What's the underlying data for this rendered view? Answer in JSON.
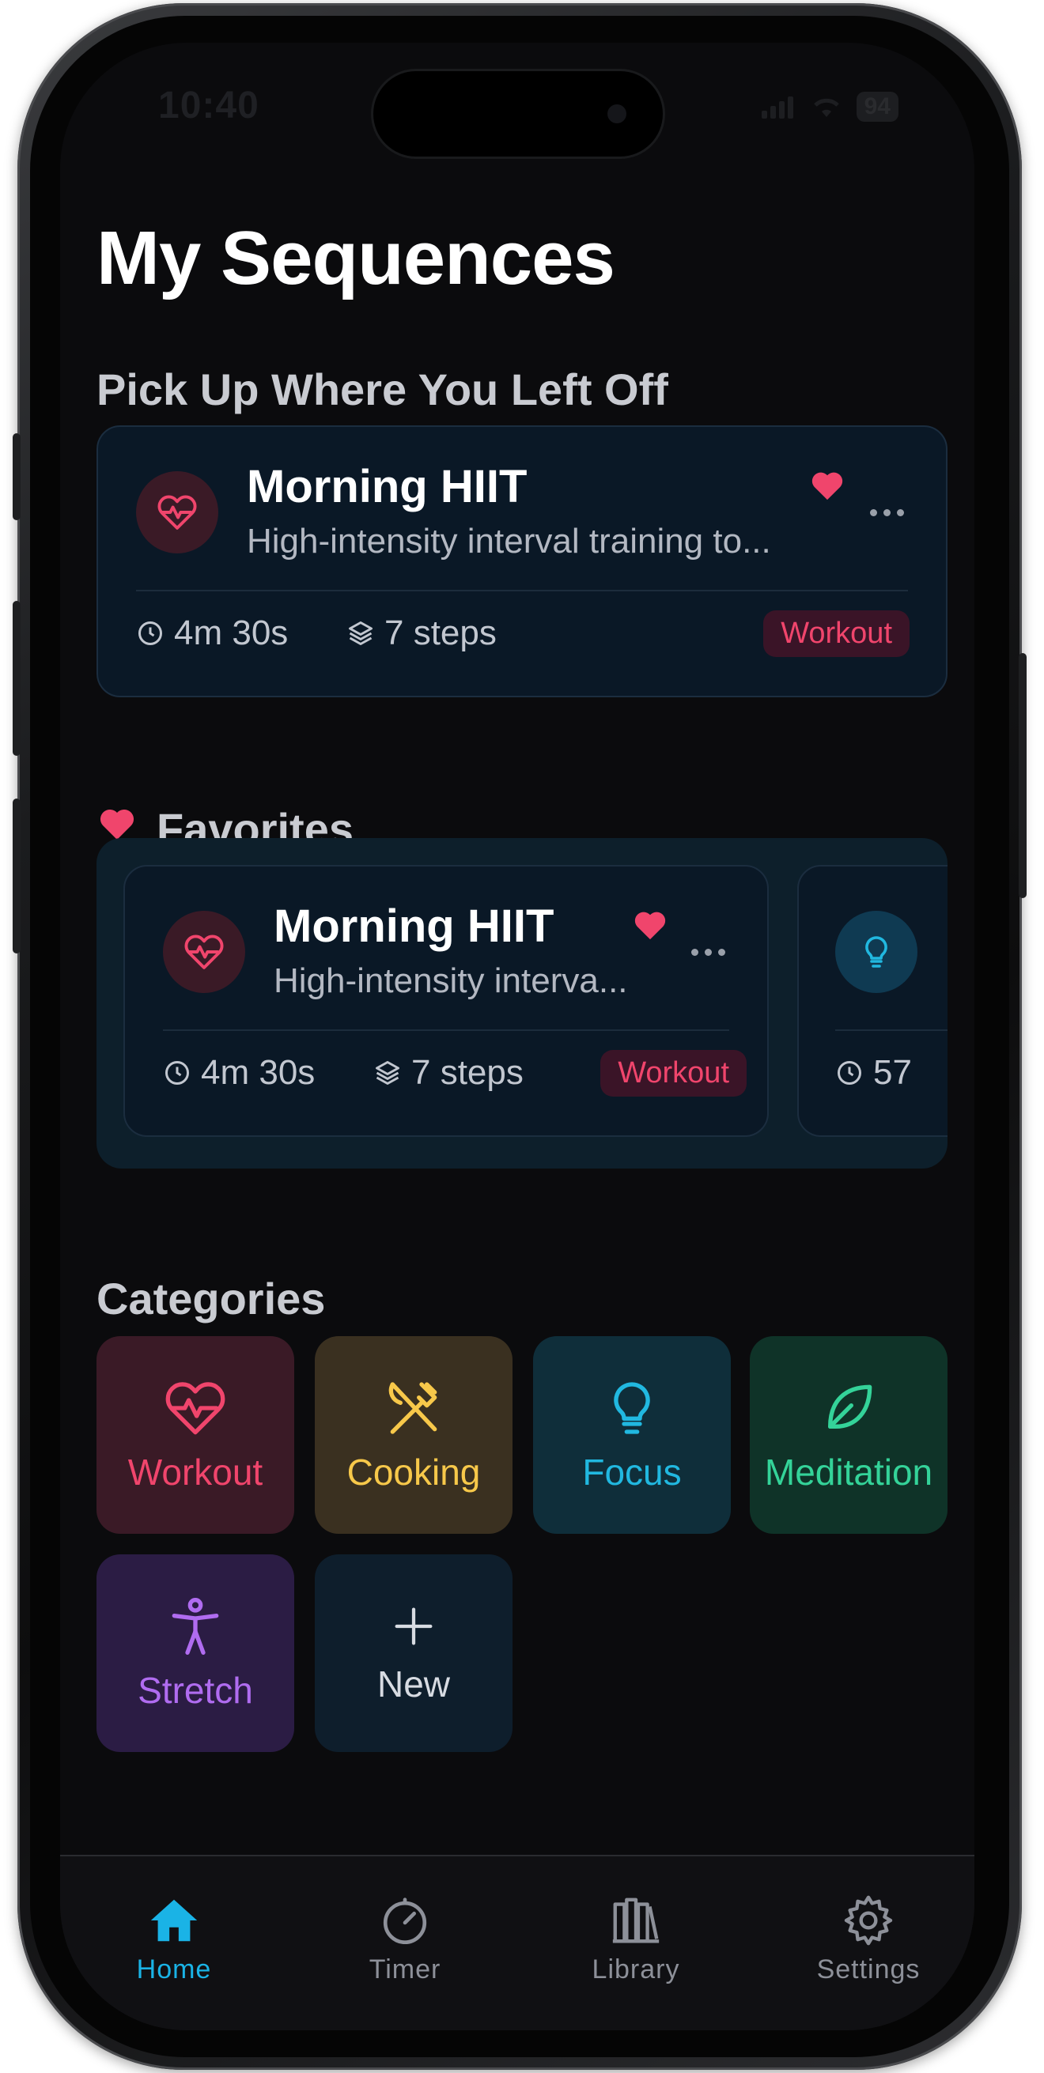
{
  "status_bar": {
    "time": "10:40",
    "battery": "94"
  },
  "page": {
    "title": "My Sequences"
  },
  "continue_section": {
    "title": "Pick Up Where You Left Off",
    "card": {
      "title": "Morning HIIT",
      "description": "High-intensity interval training to...",
      "duration": "4m 30s",
      "steps": "7 steps",
      "category": "Workout",
      "favorited": true
    }
  },
  "favorites_section": {
    "title": "Favorites",
    "cards": [
      {
        "title": "Morning HIIT",
        "description": "High-intensity interva...",
        "duration": "4m 30s",
        "steps": "7 steps",
        "category": "Workout",
        "favorited": true
      },
      {
        "duration_partial": "57"
      }
    ]
  },
  "categories_section": {
    "title": "Categories",
    "items": [
      {
        "label": "Workout",
        "icon": "heart-pulse-icon",
        "color": "#f0456c",
        "bg": "#3a1a26"
      },
      {
        "label": "Cooking",
        "icon": "utensils-icon",
        "color": "#f7c84a",
        "bg": "#3a3020"
      },
      {
        "label": "Focus",
        "icon": "lightbulb-icon",
        "color": "#21b8e0",
        "bg": "#0f2e3a"
      },
      {
        "label": "Meditation",
        "icon": "leaf-icon",
        "color": "#34d399",
        "bg": "#0f3328"
      },
      {
        "label": "Stretch",
        "icon": "person-stretch-icon",
        "color": "#b06cf0",
        "bg": "#2b1c44"
      },
      {
        "label": "New",
        "icon": "plus-icon",
        "color": "#d7dbe2",
        "bg": "#0e1e2c"
      }
    ]
  },
  "tab_bar": {
    "tabs": [
      {
        "label": "Home",
        "icon": "house-icon",
        "active": true
      },
      {
        "label": "Timer",
        "icon": "timer-icon",
        "active": false
      },
      {
        "label": "Library",
        "icon": "books-icon",
        "active": false
      },
      {
        "label": "Settings",
        "icon": "gear-icon",
        "active": false
      }
    ],
    "active_color": "#1ab3e6",
    "inactive_color": "#8d9099"
  }
}
